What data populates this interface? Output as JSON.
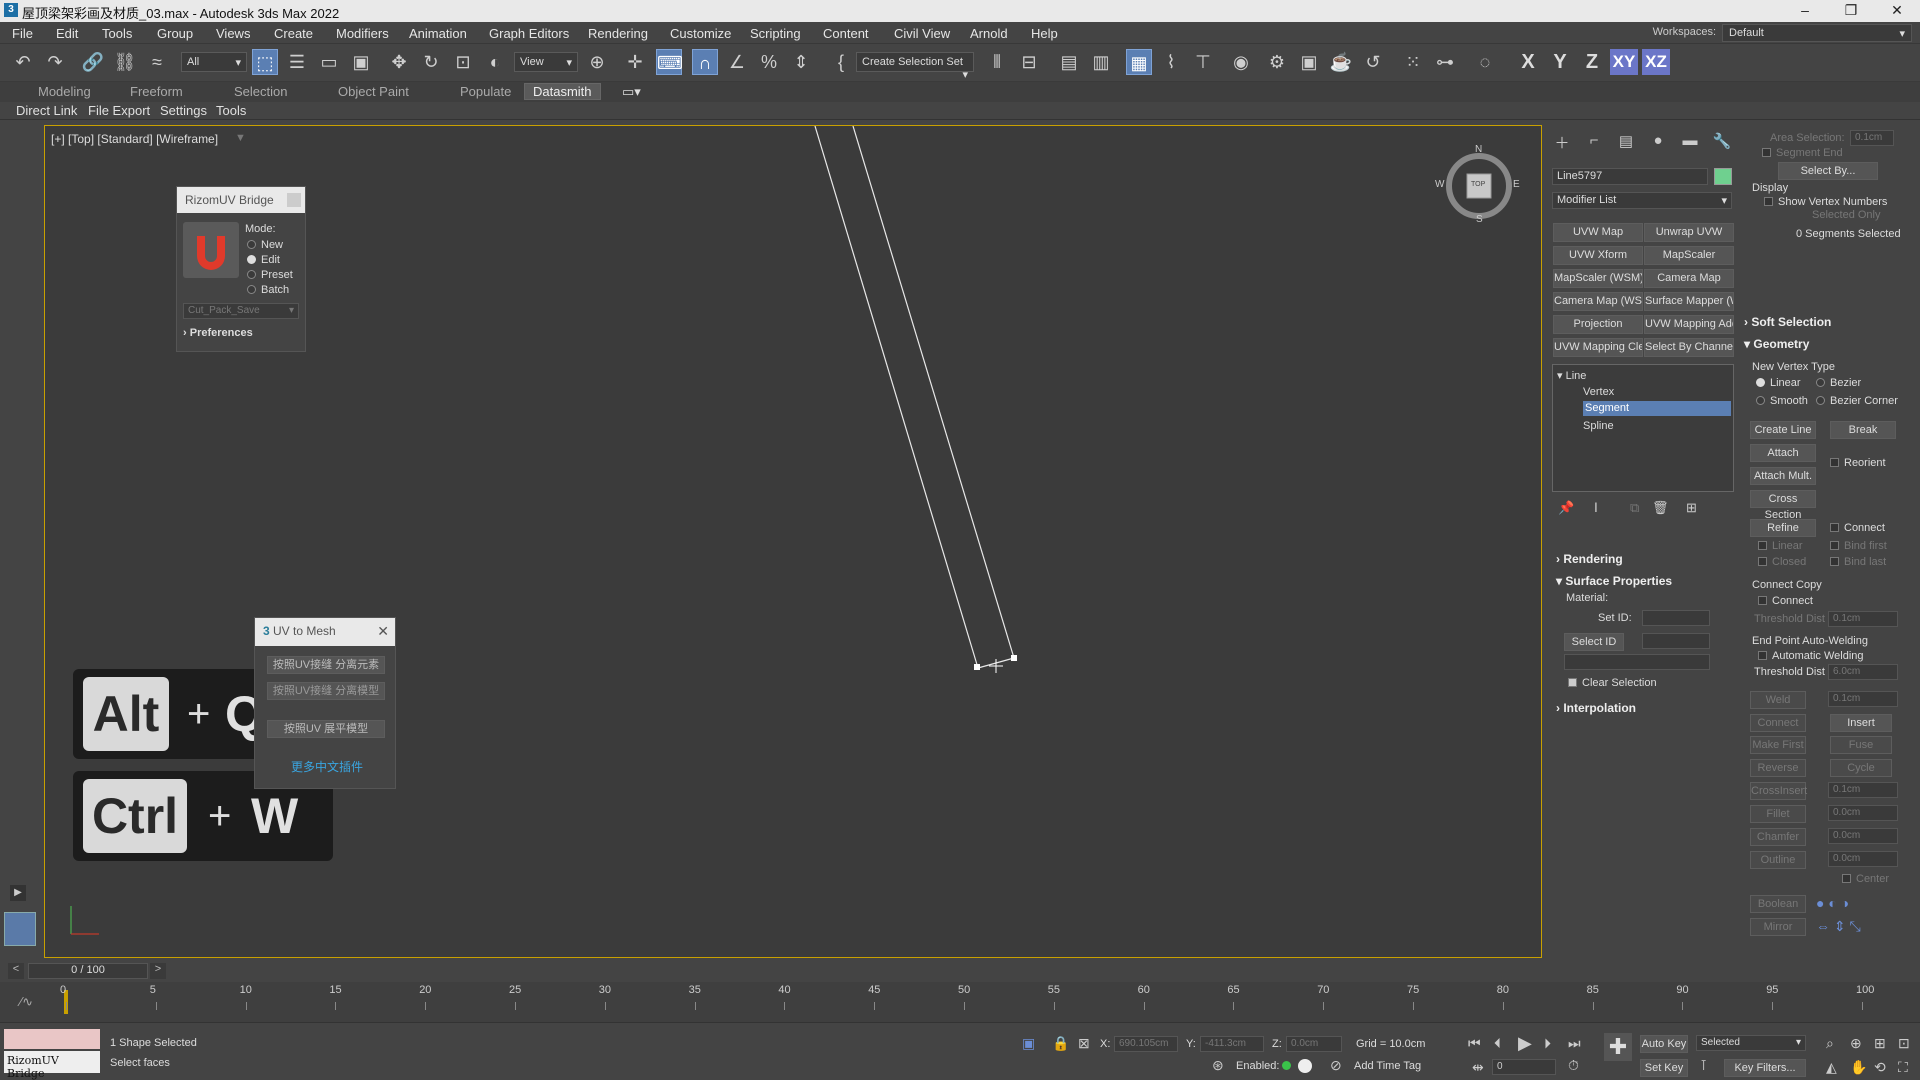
{
  "window": {
    "title": "屋顶梁架彩画及材质_03.max - Autodesk 3ds Max 2022",
    "app_icon": "3"
  },
  "menubar": {
    "items": [
      "File",
      "Edit",
      "Tools",
      "Group",
      "Views",
      "Create",
      "Modifiers",
      "Animation",
      "Graph Editors",
      "Rendering",
      "Customize",
      "Scripting",
      "Content",
      "Civil View",
      "Arnold",
      "Help"
    ],
    "workspaces_label": "Workspaces:",
    "workspace_value": "Default"
  },
  "toolbar": {
    "filter_value": "All",
    "view_value": "View",
    "selection_set_value": "Create Selection Set",
    "axis_x": "X",
    "axis_y": "Y",
    "axis_z": "Z",
    "axis_xy": "XY",
    "axis_xz": "XZ"
  },
  "ribbon": {
    "tabs": [
      "Modeling",
      "Freeform",
      "Selection",
      "Object Paint",
      "Populate",
      "Datasmith"
    ],
    "active_tab": "Datasmith",
    "subtabs": [
      "Direct Link",
      "File Export",
      "Settings",
      "Tools"
    ]
  },
  "viewport": {
    "label": "[+] [Top] [Standard] [Wireframe]",
    "viewcube_top": "TOP",
    "compass": {
      "n": "N",
      "s": "S",
      "e": "E",
      "w": "W"
    }
  },
  "rizom_panel": {
    "title": "RizomUV Bridge",
    "mode_label": "Mode:",
    "modes": [
      "New",
      "Edit",
      "Preset",
      "Batch"
    ],
    "selected_mode": "Edit",
    "preset_value": "Cut_Pack_Save",
    "preferences": "Preferences"
  },
  "uv_mesh_panel": {
    "title": "UV to Mesh",
    "buttons": [
      "按照UV接缝 分离元素",
      "按照UV接缝 分离模型",
      "按照UV 展平模型"
    ],
    "link": "更多中文插件"
  },
  "shortcuts": [
    {
      "mod": "Alt",
      "plus": "+",
      "key": "Q"
    },
    {
      "mod": "Ctrl",
      "plus": "+",
      "key": "W"
    }
  ],
  "command_panel": {
    "object_name": "Line5797",
    "object_color": "#6fd08f",
    "modifier_list": "Modifier List",
    "modifier_buttons": [
      "UVW Map",
      "Unwrap UVW",
      "UVW Xform",
      "MapScaler",
      "MapScaler (WSM)",
      "Camera Map",
      "Camera Map (WSM)",
      "Surface Mapper (WSM)",
      "Projection",
      "UVW Mapping Add",
      "UVW Mapping Clear",
      "Select By Channel"
    ],
    "stack": {
      "root": "Line",
      "items": [
        "Vertex",
        "Segment",
        "Spline"
      ],
      "selected": "Segment"
    },
    "rollouts_left": {
      "rendering": "Rendering",
      "surface_properties": "Surface Properties",
      "material_label": "Material:",
      "set_id": "Set ID:",
      "select_id": "Select ID",
      "clear_selection": "Clear Selection",
      "interpolation": "Interpolation"
    },
    "right": {
      "area_selection": "Area Selection:",
      "area_value": "0.1cm",
      "segment_end": "Segment End",
      "select_by": "Select By...",
      "display": "Display",
      "show_vertex_numbers": "Show Vertex Numbers",
      "selected_only": "Selected Only",
      "segments_selected": "0 Segments Selected",
      "soft_selection": "Soft Selection",
      "geometry": "Geometry",
      "new_vertex_type": "New Vertex Type",
      "linear": "Linear",
      "bezier": "Bezier",
      "smooth": "Smooth",
      "bezier_corner": "Bezier Corner",
      "create_line": "Create Line",
      "break": "Break",
      "attach": "Attach",
      "reorient": "Reorient",
      "attach_mult": "Attach Mult.",
      "cross_section": "Cross Section",
      "refine": "Refine",
      "connect": "Connect",
      "linear2": "Linear",
      "bind_first": "Bind first",
      "closed": "Closed",
      "bind_last": "Bind last",
      "connect_copy": "Connect Copy",
      "connect2": "Connect",
      "threshold_dist": "Threshold Dist",
      "threshold_value": "0.1cm",
      "end_point_welding": "End Point Auto-Welding",
      "automatic_welding": "Automatic Welding",
      "threshold_dist2": "Threshold Dist",
      "threshold_value2": "6.0cm",
      "weld": "Weld",
      "weld_value": "0.1cm",
      "connect3": "Connect",
      "insert": "Insert",
      "make_first": "Make First",
      "fuse": "Fuse",
      "reverse": "Reverse",
      "cycle": "Cycle",
      "crossinsert": "CrossInsert",
      "crossinsert_value": "0.1cm",
      "fillet": "Fillet",
      "fillet_value": "0.0cm",
      "chamfer": "Chamfer",
      "chamfer_value": "0.0cm",
      "outline": "Outline",
      "outline_value": "0.0cm",
      "center": "Center",
      "boolean": "Boolean",
      "mirror": "Mirror"
    }
  },
  "timeline": {
    "frame_display": "0 / 100",
    "ticks": [
      "0",
      "5",
      "10",
      "15",
      "20",
      "25",
      "30",
      "35",
      "40",
      "45",
      "50",
      "55",
      "60",
      "65",
      "70",
      "75",
      "80",
      "85",
      "90",
      "95",
      "100"
    ]
  },
  "statusbar": {
    "selection_status": "1 Shape Selected",
    "prompt": "Select faces",
    "taskbar_label": "RizomUV Bridge",
    "x_label": "X:",
    "x_value": "690.105cm",
    "y_label": "Y:",
    "y_value": "-411.3cm",
    "z_label": "Z:",
    "z_value": "0.0cm",
    "grid": "Grid = 10.0cm",
    "enabled": "Enabled:",
    "add_time_tag": "Add Time Tag",
    "auto_key": "Auto Key",
    "set_key": "Set Key",
    "key_mode": "Selected",
    "key_filters": "Key Filters...",
    "frame": "0"
  }
}
